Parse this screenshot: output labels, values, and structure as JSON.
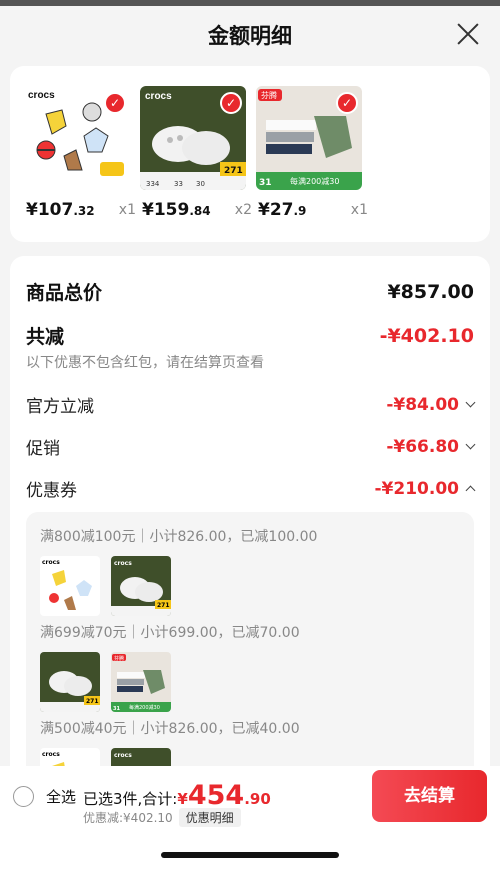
{
  "header": {
    "title": "金额明细"
  },
  "products": [
    {
      "brand": "crocs",
      "price_int": "¥107",
      "price_dec": ".32",
      "qty": "x1"
    },
    {
      "brand": "crocs",
      "price_int": "¥159",
      "price_dec": ".84",
      "qty": "x2",
      "badge": "271",
      "stats": [
        "334",
        "33",
        "30"
      ]
    },
    {
      "brand": "芬腾",
      "price_int": "¥27",
      "price_dec": ".9",
      "qty": "x1",
      "promo": "每满200减30",
      "badge": "31"
    }
  ],
  "summary": {
    "total_label": "商品总价",
    "total_value": "¥857.00",
    "reduce_label": "共减",
    "reduce_value": "-¥402.10",
    "note": "以下优惠不包含红包，请在结算页查看",
    "official_label": "官方立减",
    "official_value": "-¥84.00",
    "promo_label": "促销",
    "promo_value": "-¥66.80",
    "coupon_label": "优惠券",
    "coupon_value": "-¥210.00"
  },
  "coupon_groups": [
    {
      "title": "满800减100元｜小计826.00，已减100.00"
    },
    {
      "title": "满699减70元｜小计699.00，已减70.00"
    },
    {
      "title": "满500减40元｜小计826.00，已减40.00"
    }
  ],
  "bottom": {
    "select_all": "全选",
    "summary_prefix": "已选3件,合计:",
    "yen": "¥",
    "total_int": "454",
    "total_dec": ".90",
    "discount": "优惠减:¥402.10",
    "detail_tag": "优惠明细",
    "pay_button": "去结算"
  },
  "colors": {
    "accent": "#e8282d",
    "background": "#f4f4f4"
  }
}
